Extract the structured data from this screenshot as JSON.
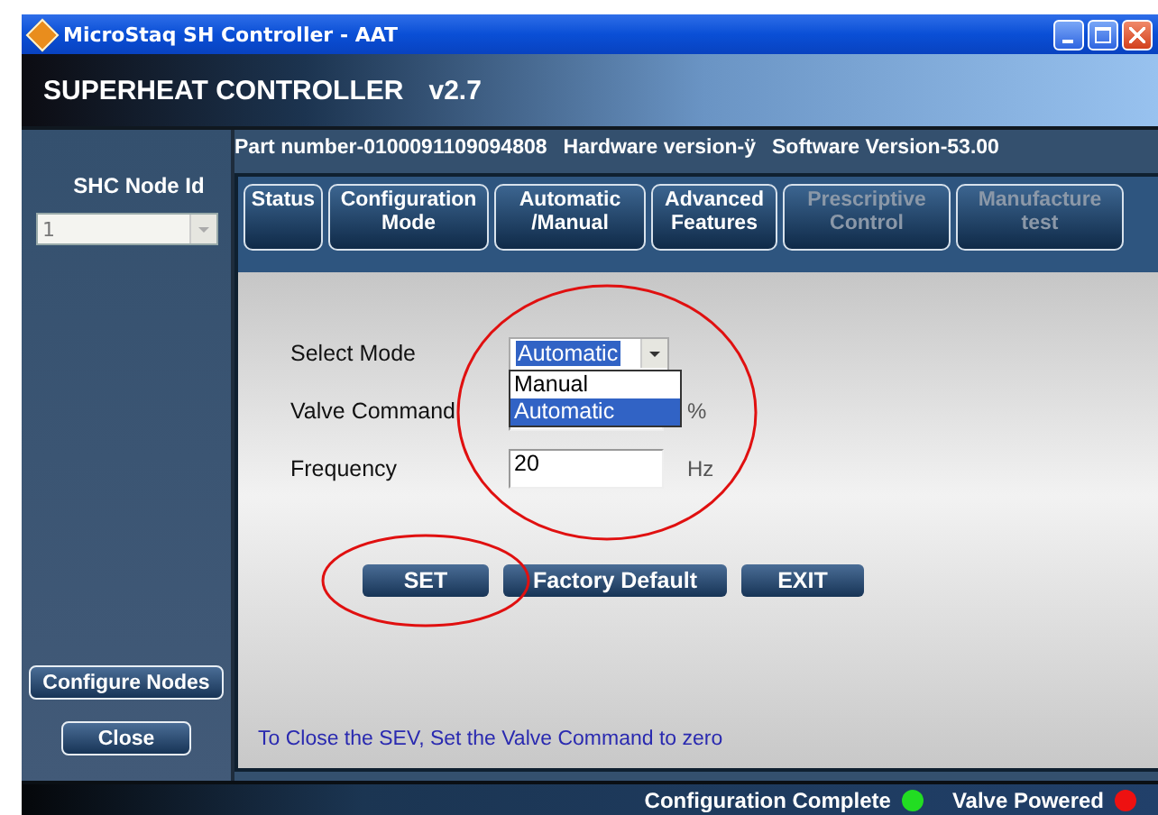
{
  "window": {
    "title": "MicroStaq SH Controller - AAT"
  },
  "header": {
    "title": "SUPERHEAT CONTROLLER",
    "version": "v2.7"
  },
  "info": [
    "Part number-0100091109094808",
    "Hardware version-ÿ",
    "Software Version-53.00"
  ],
  "sidebar": {
    "label": "SHC Node Id",
    "node_select": {
      "value": "1",
      "disabled": true
    },
    "buttons": [
      "Configure Nodes",
      "Close"
    ]
  },
  "tabs": [
    {
      "label": "Status",
      "disabled": false
    },
    {
      "label": "Configuration\nMode",
      "disabled": false
    },
    {
      "label": "Automatic\n/Manual",
      "disabled": false
    },
    {
      "label": "Advanced\nFeatures",
      "disabled": false
    },
    {
      "label": "Prescriptive\nControl",
      "disabled": true
    },
    {
      "label": "Manufacture\ntest",
      "disabled": true
    }
  ],
  "form": {
    "mode": {
      "label": "Select Mode",
      "value": "Automatic",
      "expanded": true,
      "options": [
        {
          "label": "Manual",
          "selected": false
        },
        {
          "label": "Automatic",
          "selected": true
        }
      ]
    },
    "valve": {
      "label": "Valve Command",
      "unit": "%"
    },
    "frequency": {
      "label": "Frequency",
      "value": "20",
      "unit": "Hz"
    }
  },
  "buttons": [
    "SET",
    "Factory Default",
    "EXIT"
  ],
  "note": "To Close the SEV, Set the Valve Command to zero",
  "annotations": {
    "mode_fields_circled": true,
    "set_button_circled": true
  },
  "status_bar": [
    {
      "label": "Configuration Complete",
      "color": "#22dd22"
    },
    {
      "label": "Valve Powered",
      "color": "#ee1111"
    }
  ]
}
